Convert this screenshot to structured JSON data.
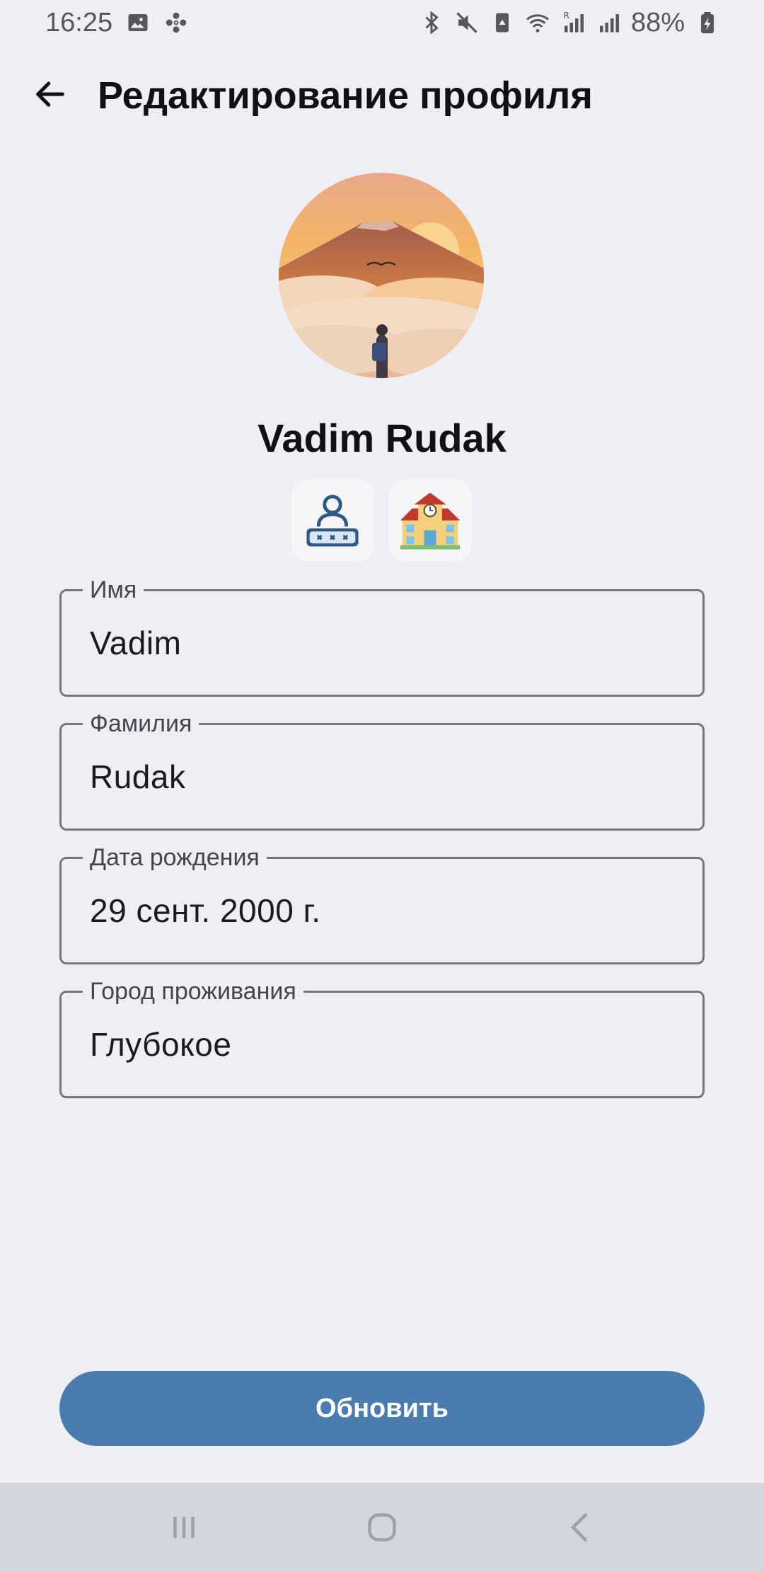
{
  "status_bar": {
    "time": "16:25",
    "battery": "88%",
    "icons": [
      "gallery-icon",
      "fan-icon",
      "bluetooth-icon",
      "mute-icon",
      "recycle-icon",
      "wifi-icon",
      "signal-r-icon",
      "signal-icon",
      "battery-charging-icon"
    ]
  },
  "header": {
    "title": "Редактирование профиля",
    "back_icon": "arrow-left-icon"
  },
  "profile": {
    "name": "Vadim Rudak",
    "badges": [
      "password-user-icon",
      "school-building-icon"
    ]
  },
  "form": {
    "first_name": {
      "label": "Имя",
      "value": "Vadim"
    },
    "last_name": {
      "label": "Фамилия",
      "value": "Rudak"
    },
    "birth_date": {
      "label": "Дата рождения",
      "value": "29 сент. 2000 г."
    },
    "city": {
      "label": "Город проживания",
      "value": "Глубокое"
    }
  },
  "actions": {
    "update_label": "Обновить"
  },
  "colors": {
    "background": "#eeeff5",
    "primary_button": "#4a7caf",
    "field_border": "#76777f",
    "nav_bar": "#d3d5dd"
  },
  "nav_bar": [
    "recent-apps-icon",
    "home-icon",
    "back-icon"
  ]
}
